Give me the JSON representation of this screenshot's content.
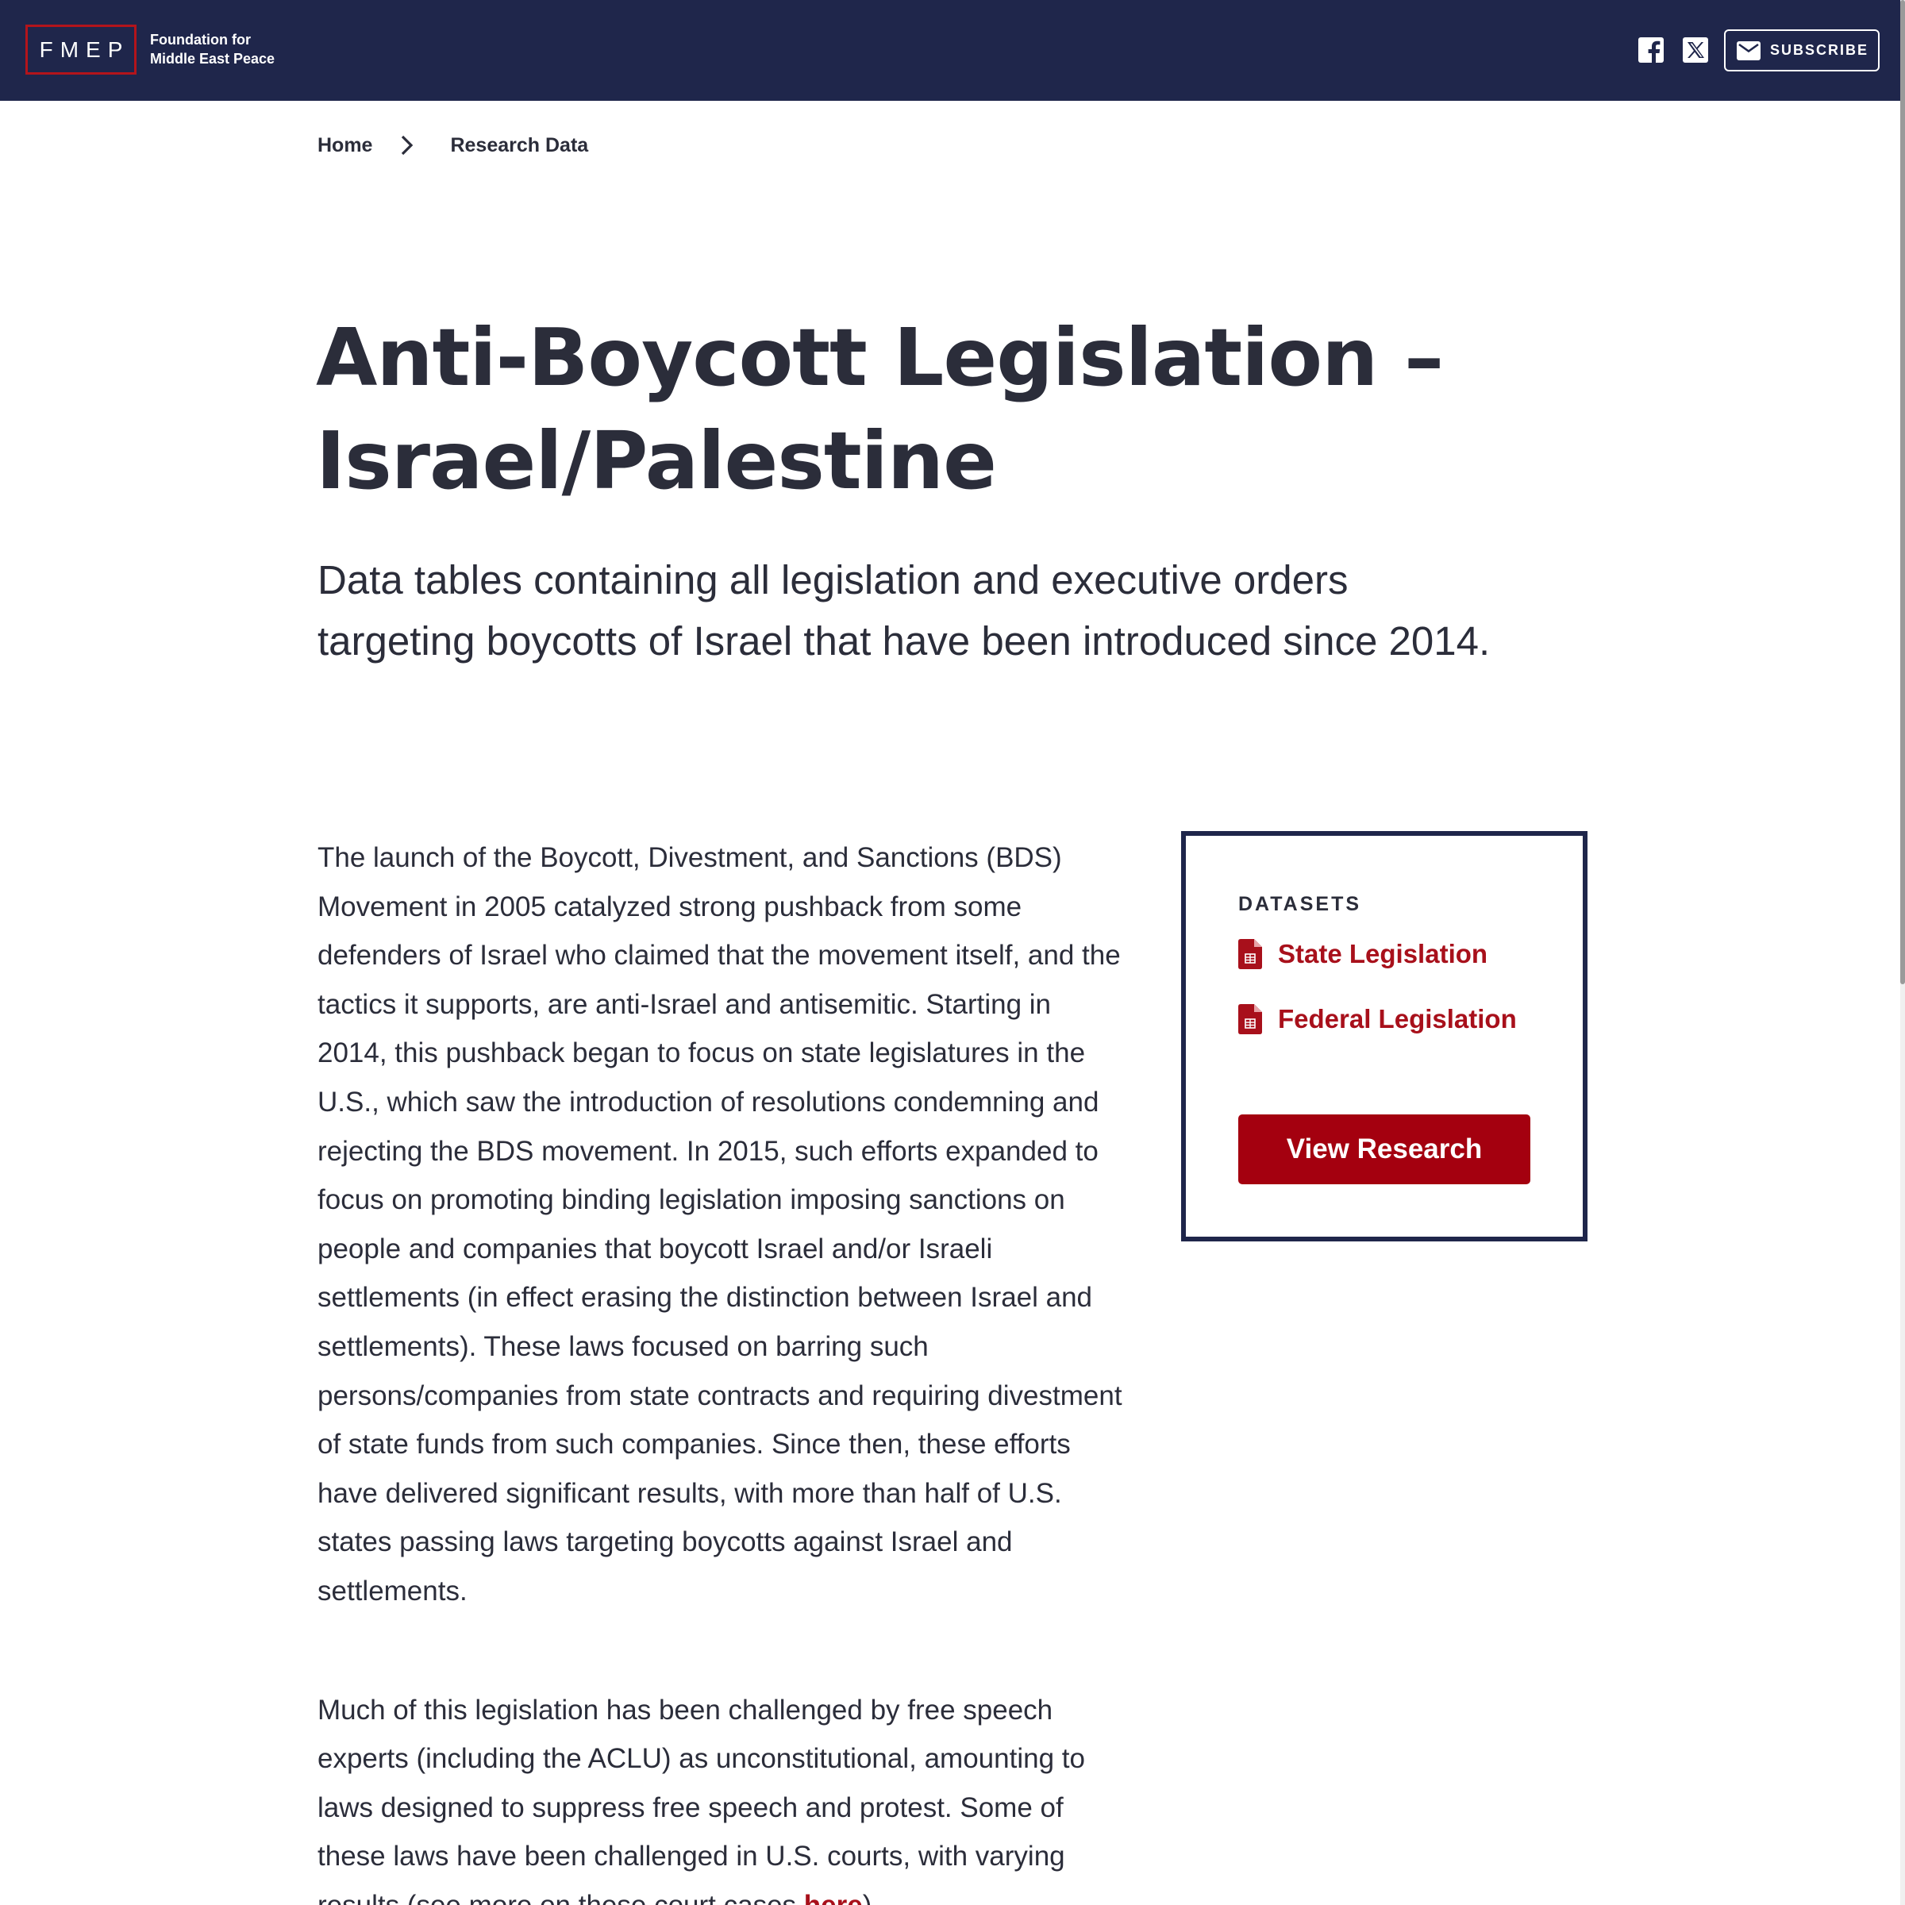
{
  "header": {
    "logo_mark": "FMEP",
    "org_name_line1": "Foundation for",
    "org_name_line2": "Middle East Peace",
    "subscribe_label": "SUBSCRIBE",
    "icons": [
      "facebook-icon",
      "x-icon",
      "mail-icon"
    ]
  },
  "breadcrumb": {
    "home": "Home",
    "current": "Research Data"
  },
  "page": {
    "title_line1": "Anti-Boycott Legislation –",
    "title_line2": "Israel/Palestine",
    "lede": "Data tables containing all legislation and executive orders targeting boycotts of Israel that have been introduced since 2014.",
    "paragraph1": "The launch of the Boycott, Divestment, and Sanctions (BDS) Movement in 2005 catalyzed strong pushback from some defenders of Israel who claimed that the movement itself, and the tactics it supports, are anti-Israel and antisemitic. Starting in 2014, this pushback began to focus on state legislatures in the U.S., which saw the introduction of resolutions condemning and rejecting the BDS movement. In 2015, such efforts expanded to focus on promoting binding legislation imposing sanctions on people and companies that boycott Israel and/or Israeli settlements (in effect erasing the distinction between Israel and settlements). These laws focused on barring such persons/companies from state contracts and requiring divestment of state funds from such companies. Since then, these efforts have delivered significant results, with more than half of U.S. states passing laws targeting boycotts against Israel and settlements.",
    "paragraph2_before_link": "Much of this legislation has been challenged by free speech experts (including the ACLU) as unconstitutional, amounting to laws designed to suppress free speech and protest. Some of these laws have been challenged in U.S. courts, with varying results (see more on these court cases ",
    "paragraph2_link": "here",
    "paragraph2_after_link": ")."
  },
  "datasets": {
    "label": "DATASETS",
    "items": [
      "State Legislation",
      "Federal Legislation"
    ],
    "button_label": "View Research"
  },
  "colors": {
    "header_bg": "#1f264b",
    "accent_red": "#a8101b",
    "button_red": "#a4000f",
    "text": "#2b2d3a"
  }
}
